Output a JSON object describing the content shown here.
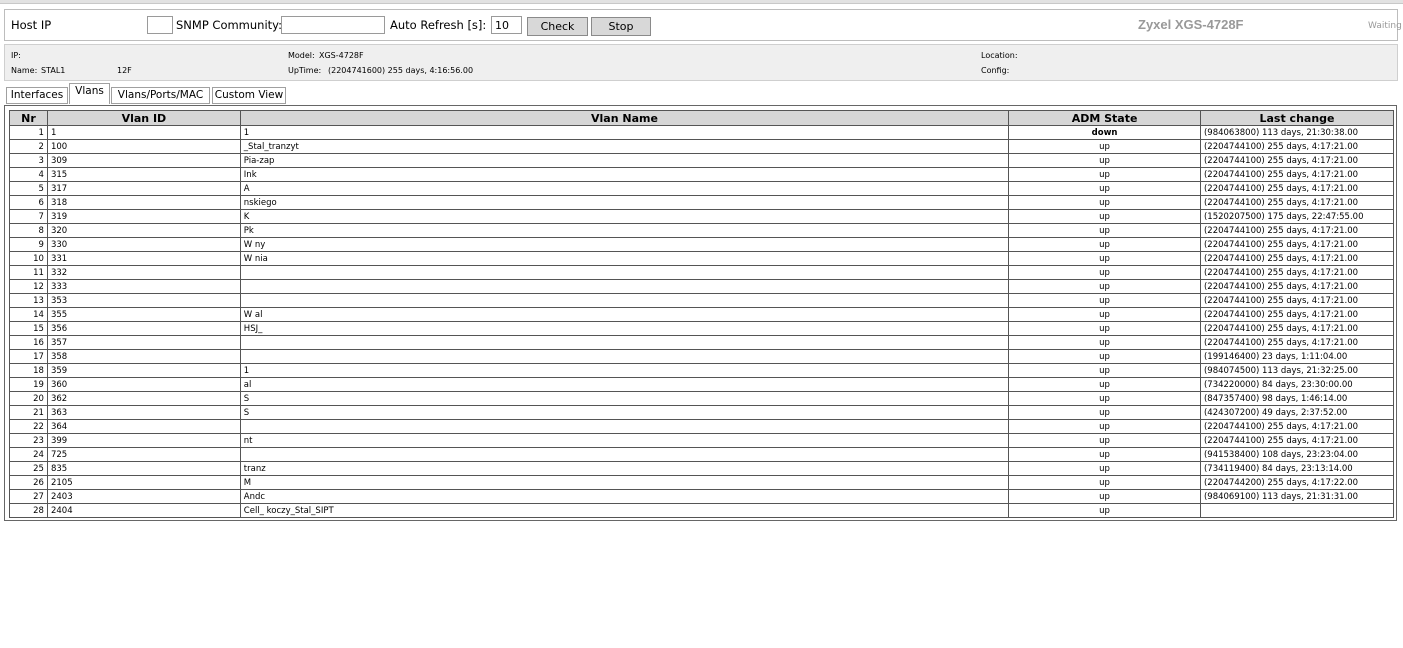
{
  "toolbar": {
    "host_ip_label": "Host IP",
    "host_ip_value": "",
    "snmp_label": "SNMP Community:",
    "snmp_value": "",
    "refresh_label": "Auto Refresh [s]:",
    "refresh_value": "10",
    "check_label": "Check",
    "stop_label": "Stop",
    "brand": "Zyxel XGS-4728F",
    "status": "Waiting"
  },
  "info": {
    "ip_label": "IP:",
    "name_label": "Name:",
    "name_value": "STAL1",
    "name_suffix": "12F",
    "model_label": "Model:",
    "model_value": "XGS-4728F",
    "uptime_label": "UpTime:",
    "uptime_value": "(2204741600) 255 days, 4:16:56.00",
    "location_label": "Location:",
    "config_label": "Config:"
  },
  "tabs": [
    "Interfaces",
    "Vlans",
    "Vlans/Ports/MAC",
    "Custom View"
  ],
  "table": {
    "headers": [
      "Nr",
      "Vlan ID",
      "Vlan Name",
      "ADM State",
      "Last change"
    ],
    "rows": [
      [
        "1",
        "1",
        "1",
        "down",
        "(984063800) 113 days, 21:30:38.00"
      ],
      [
        "2",
        "100",
        "_Stal_tranzyt",
        "up",
        "(2204744100) 255 days, 4:17:21.00"
      ],
      [
        "3",
        "309",
        "Pia-zap",
        "up",
        "(2204744100) 255 days, 4:17:21.00"
      ],
      [
        "4",
        "315",
        "Ink",
        "up",
        "(2204744100) 255 days, 4:17:21.00"
      ],
      [
        "5",
        "317",
        "A",
        "up",
        "(2204744100) 255 days, 4:17:21.00"
      ],
      [
        "6",
        "318",
        "nskiego",
        "up",
        "(2204744100) 255 days, 4:17:21.00"
      ],
      [
        "7",
        "319",
        "K",
        "up",
        "(1520207500) 175 days, 22:47:55.00"
      ],
      [
        "8",
        "320",
        "Pk",
        "up",
        "(2204744100) 255 days, 4:17:21.00"
      ],
      [
        "9",
        "330",
        "W ny",
        "up",
        "(2204744100) 255 days, 4:17:21.00"
      ],
      [
        "10",
        "331",
        "W nia",
        "up",
        "(2204744100) 255 days, 4:17:21.00"
      ],
      [
        "11",
        "332",
        "",
        "up",
        "(2204744100) 255 days, 4:17:21.00"
      ],
      [
        "12",
        "333",
        "",
        "up",
        "(2204744100) 255 days, 4:17:21.00"
      ],
      [
        "13",
        "353",
        "",
        "up",
        "(2204744100) 255 days, 4:17:21.00"
      ],
      [
        "14",
        "355",
        "W al",
        "up",
        "(2204744100) 255 days, 4:17:21.00"
      ],
      [
        "15",
        "356",
        "HSJ_",
        "up",
        "(2204744100) 255 days, 4:17:21.00"
      ],
      [
        "16",
        "357",
        "",
        "up",
        "(2204744100) 255 days, 4:17:21.00"
      ],
      [
        "17",
        "358",
        "",
        "up",
        "(199146400) 23 days, 1:11:04.00"
      ],
      [
        "18",
        "359",
        "1",
        "up",
        "(984074500) 113 days, 21:32:25.00"
      ],
      [
        "19",
        "360",
        "al",
        "up",
        "(734220000) 84 days, 23:30:00.00"
      ],
      [
        "20",
        "362",
        "S",
        "up",
        "(847357400) 98 days, 1:46:14.00"
      ],
      [
        "21",
        "363",
        "S",
        "up",
        "(424307200) 49 days, 2:37:52.00"
      ],
      [
        "22",
        "364",
        "",
        "up",
        "(2204744100) 255 days, 4:17:21.00"
      ],
      [
        "23",
        "399",
        "nt",
        "up",
        "(2204744100) 255 days, 4:17:21.00"
      ],
      [
        "24",
        "725",
        "",
        "up",
        "(941538400) 108 days, 23:23:04.00"
      ],
      [
        "25",
        "835",
        "tranz",
        "up",
        "(734119400) 84 days, 23:13:14.00"
      ],
      [
        "26",
        "2105",
        "M",
        "up",
        "(2204744200) 255 days, 4:17:22.00"
      ],
      [
        "27",
        "2403",
        "Andc",
        "up",
        "(984069100) 113 days, 21:31:31.00"
      ],
      [
        "28",
        "2404",
        "Cell_ koczy_Stal_SIPT",
        "up",
        ""
      ]
    ]
  }
}
